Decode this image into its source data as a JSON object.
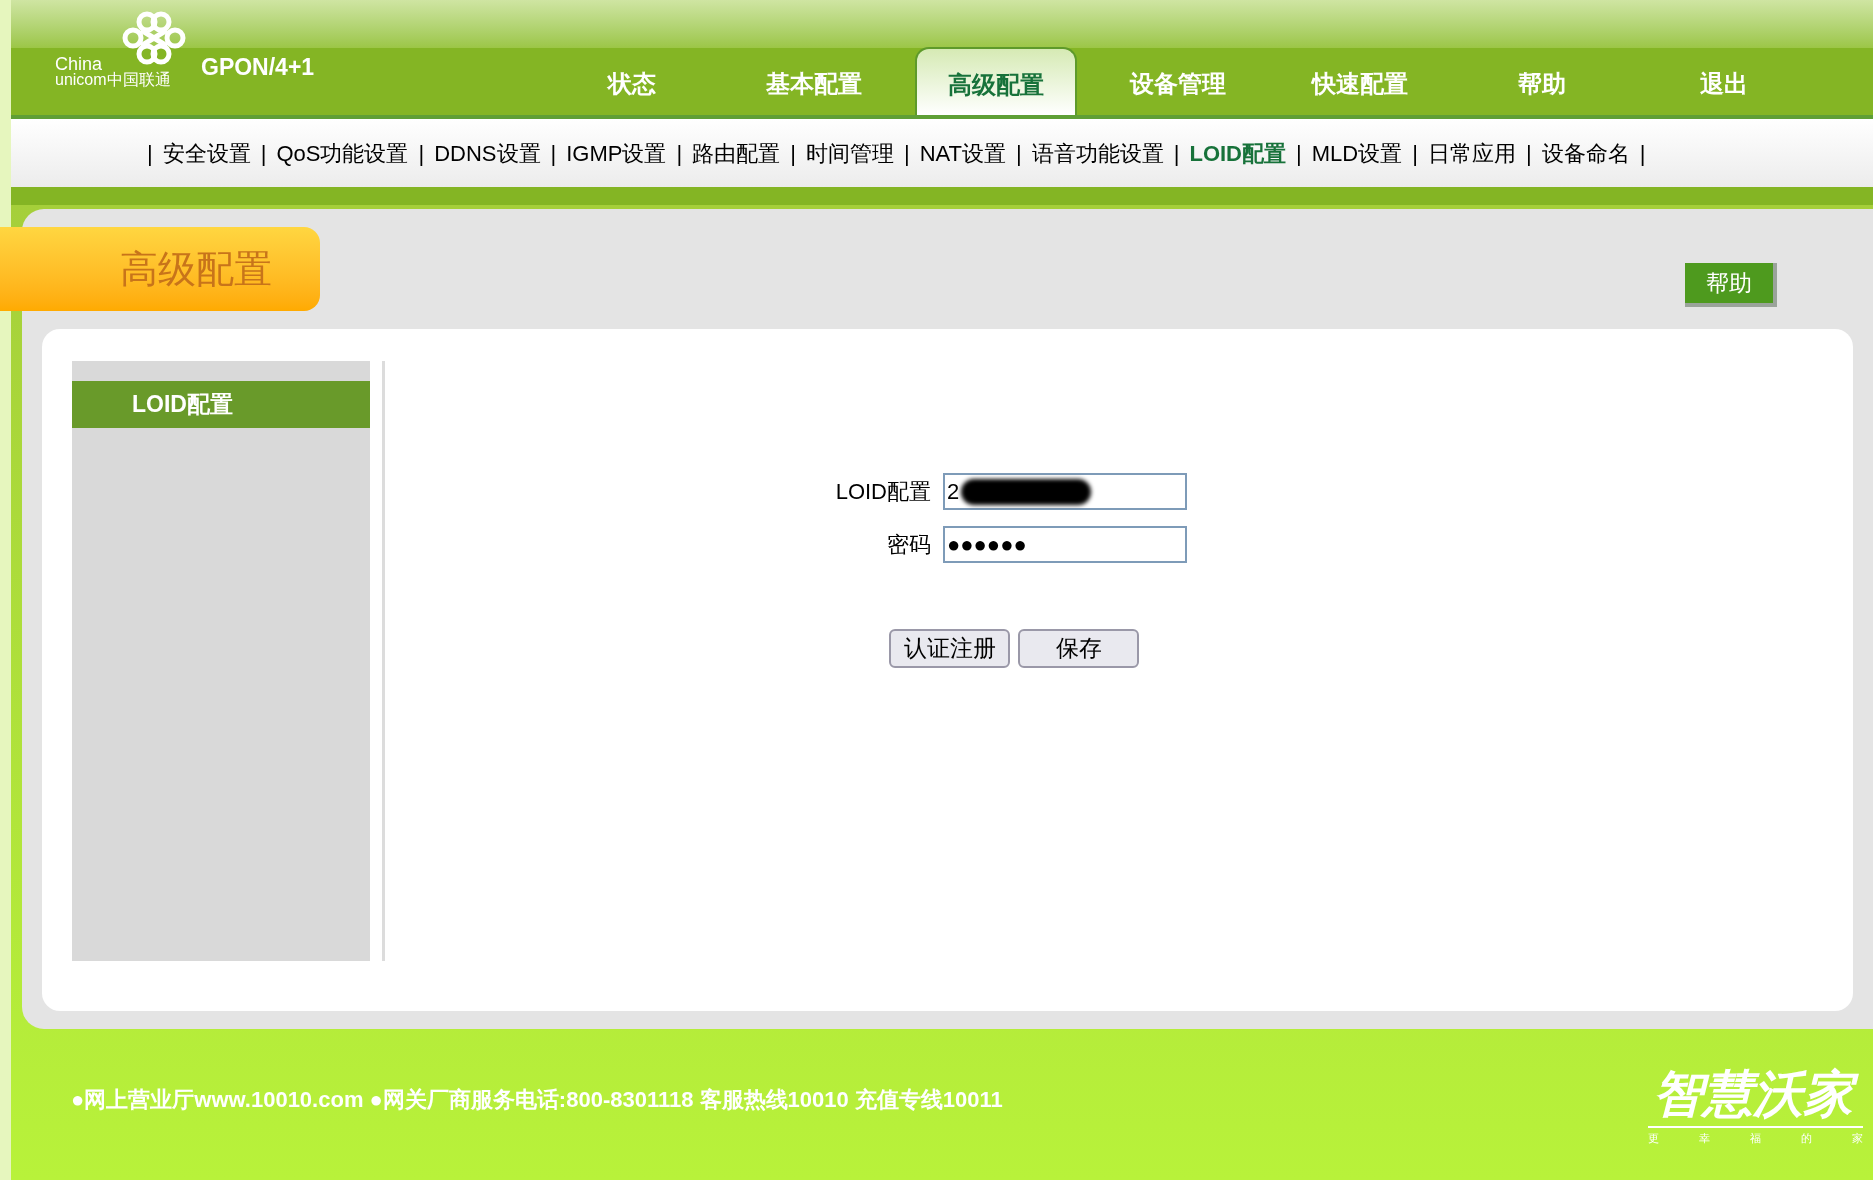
{
  "logo": {
    "line_1": "China",
    "line_2": "unicom中国联通"
  },
  "model": "GPON/4+1",
  "tabs": [
    {
      "label": "状态",
      "selected": false
    },
    {
      "label": "基本配置",
      "selected": false
    },
    {
      "label": "高级配置",
      "selected": true
    },
    {
      "label": "设备管理",
      "selected": false
    },
    {
      "label": "快速配置",
      "selected": false
    },
    {
      "label": "帮助",
      "selected": false
    },
    {
      "label": "退出",
      "selected": false
    }
  ],
  "separator": "|",
  "subnav": [
    {
      "label": "安全设置",
      "selected": false
    },
    {
      "label": "QoS功能设置",
      "selected": false
    },
    {
      "label": "DDNS设置",
      "selected": false
    },
    {
      "label": "IGMP设置",
      "selected": false
    },
    {
      "label": "路由配置",
      "selected": false
    },
    {
      "label": "时间管理",
      "selected": false
    },
    {
      "label": "NAT设置",
      "selected": false
    },
    {
      "label": "语音功能设置",
      "selected": false
    },
    {
      "label": "LOID配置",
      "selected": true
    },
    {
      "label": "MLD设置",
      "selected": false
    },
    {
      "label": "日常应用",
      "selected": false
    },
    {
      "label": "设备命名",
      "selected": false
    }
  ],
  "page_title": "高级配置",
  "help_button": "帮助",
  "sidebar": {
    "items": [
      {
        "label": "LOID配置",
        "selected": true
      }
    ]
  },
  "form": {
    "fields": [
      {
        "label": "LOID配置",
        "value": "2",
        "redacted": true
      },
      {
        "label": "密码",
        "value": "●●●●●●",
        "redacted": false
      }
    ],
    "buttons": [
      "认证注册",
      "保存"
    ]
  },
  "footer": {
    "text": "●网上营业厅www.10010.com ●网关厂商服务电话:800-8301118 客服热线10010 充值专线10011",
    "brand": "智慧沃家",
    "slogan": [
      "更",
      "幸",
      "福",
      "的",
      "家"
    ]
  }
}
